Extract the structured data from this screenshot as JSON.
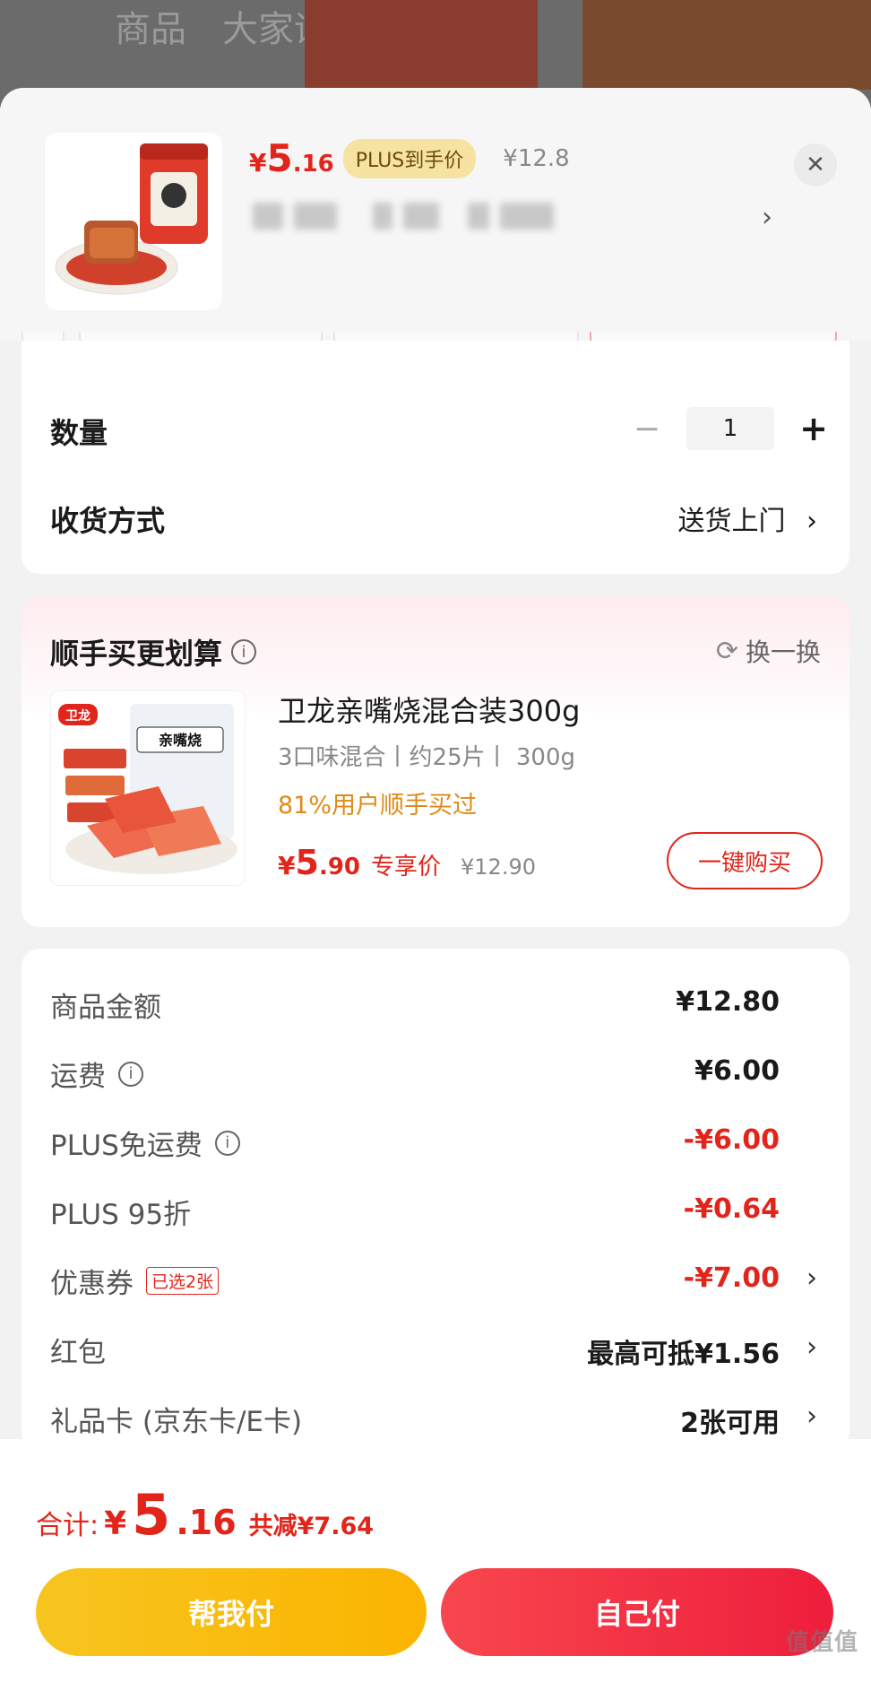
{
  "background": {
    "tabs": [
      "商品",
      "大家评"
    ]
  },
  "product": {
    "price_symbol": "¥",
    "price_int": "5",
    "price_dec": ".16",
    "plus_badge": "PLUS到手价",
    "orig_price": "¥12.8"
  },
  "quantity": {
    "label": "数量",
    "value": "1",
    "minus": "−",
    "plus": "+"
  },
  "delivery": {
    "label": "收货方式",
    "value": "送货上门"
  },
  "addon": {
    "title": "顺手买更划算",
    "swap": "换一换",
    "name": "卫龙亲嘴烧混合装300g",
    "spec": "3口味混合丨约25片丨 300g",
    "stat": "81%用户顺手买过",
    "price_symbol": "¥",
    "price_int": "5",
    "price_dec": ".90",
    "exclusive": "专享价",
    "orig_price": "¥12.90",
    "buy_button": "一键购买",
    "img_logo": "卫龙",
    "img_brand": "亲嘴烧"
  },
  "fees": {
    "goods_label": "商品金额",
    "goods_value": "¥12.80",
    "shipping_label": "运费",
    "shipping_value": "¥6.00",
    "plus_free_label": "PLUS免运费",
    "plus_free_value": "-¥6.00",
    "plus_discount_label": "PLUS 95折",
    "plus_discount_value": "-¥0.64",
    "coupon_label": "优惠券",
    "coupon_tag": "已选2张",
    "coupon_value": "-¥7.00",
    "redpacket_label": "红包",
    "redpacket_value": "最高可抵¥1.56",
    "giftcard_label": "礼品卡 (京东卡/E卡)",
    "giftcard_value": "2张可用"
  },
  "summary": {
    "label": "合计:",
    "symbol": "¥",
    "int": "5",
    "dec": ".16",
    "saved": "共减¥7.64"
  },
  "actions": {
    "help_pay": "帮我付",
    "self_pay": "自己付"
  },
  "watermark": "值值值",
  "colors": {
    "accent_red": "#e1251b",
    "plus_gold": "#f7e3a1",
    "help_yellow": "#f7c520",
    "pay_red": "#f8474e",
    "addon_stat_orange": "#e08a17"
  }
}
